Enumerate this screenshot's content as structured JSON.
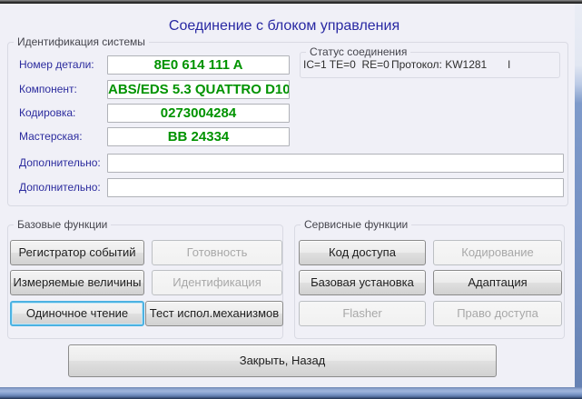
{
  "window": {
    "title": "Соединение с блоком управления"
  },
  "identification": {
    "group_label": "Идентификация системы",
    "fields": [
      {
        "label": "Номер детали:",
        "value": "8E0 614 111 A"
      },
      {
        "label": "Компонент:",
        "value": "ABS/EDS 5.3 QUATTRO D10"
      },
      {
        "label": "Кодировка:",
        "value": "0273004284"
      },
      {
        "label": "Мастерская:",
        "value": "BB 24334"
      },
      {
        "label": "Дополнительно:",
        "value": ""
      },
      {
        "label": "Дополнительно:",
        "value": ""
      }
    ]
  },
  "status": {
    "group_label": "Статус соединения",
    "counters": "IC=1 TE=0  RE=0",
    "protocol": "Протокол: KW1281",
    "indicator": "I"
  },
  "basic_functions": {
    "group_label": "Базовые функции",
    "buttons": [
      {
        "label": "Регистратор событий",
        "enabled": true,
        "focused": false
      },
      {
        "label": "Готовность",
        "enabled": false,
        "focused": false
      },
      {
        "label": "Измеряемые величины",
        "enabled": true,
        "focused": false
      },
      {
        "label": "Идентификация",
        "enabled": false,
        "focused": false
      },
      {
        "label": "Одиночное чтение",
        "enabled": true,
        "focused": true
      },
      {
        "label": "Тест испол.механизмов",
        "enabled": true,
        "focused": false
      }
    ]
  },
  "service_functions": {
    "group_label": "Сервисные функции",
    "buttons": [
      {
        "label": "Код доступа",
        "enabled": true
      },
      {
        "label": "Кодирование",
        "enabled": false
      },
      {
        "label": "Базовая установка",
        "enabled": true
      },
      {
        "label": "Адаптация",
        "enabled": true
      },
      {
        "label": "Flasher",
        "enabled": false
      },
      {
        "label": "Право доступа",
        "enabled": false
      }
    ]
  },
  "footer": {
    "close_label": "Закрыть, Назад"
  },
  "colors": {
    "value_green": "#009300",
    "label_navy": "#2b2b9e",
    "title_navy": "#2929a3",
    "focus_ring": "#4cb2e2",
    "frame_blue": "#7490c3",
    "background": "#f0f0f7"
  }
}
